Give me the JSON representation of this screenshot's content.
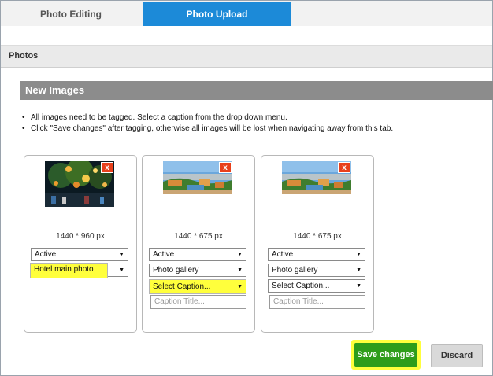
{
  "tabs": [
    {
      "label": "Photo Editing",
      "active": false
    },
    {
      "label": "Photo Upload",
      "active": true
    }
  ],
  "section_title": "Photos",
  "panel_title": "New Images",
  "instructions": [
    "All images need to be tagged. Select a caption from the drop down menu.",
    "Click \"Save changes\" after tagging, otherwise all images will be lost when navigating away from this tab."
  ],
  "cards": [
    {
      "dimensions": "1440 * 960 px",
      "status": "Active",
      "category": "Hotel main photo",
      "caption": "",
      "caption_title_placeholder": ""
    },
    {
      "dimensions": "1440 * 675 px",
      "status": "Active",
      "category": "Photo gallery",
      "caption": "Select Caption...",
      "caption_title_placeholder": "Caption Title..."
    },
    {
      "dimensions": "1440 * 675 px",
      "status": "Active",
      "category": "Photo gallery",
      "caption": "Select Caption...",
      "caption_title_placeholder": "Caption Title..."
    }
  ],
  "remove_label": "x",
  "buttons": {
    "save": "Save changes",
    "discard": "Discard"
  },
  "colors": {
    "active_tab": "#1c8ad8",
    "highlight": "#ffff3c",
    "save": "#2e9d1a",
    "remove": "#e8401c",
    "panel_header": "#8c8c8c"
  }
}
